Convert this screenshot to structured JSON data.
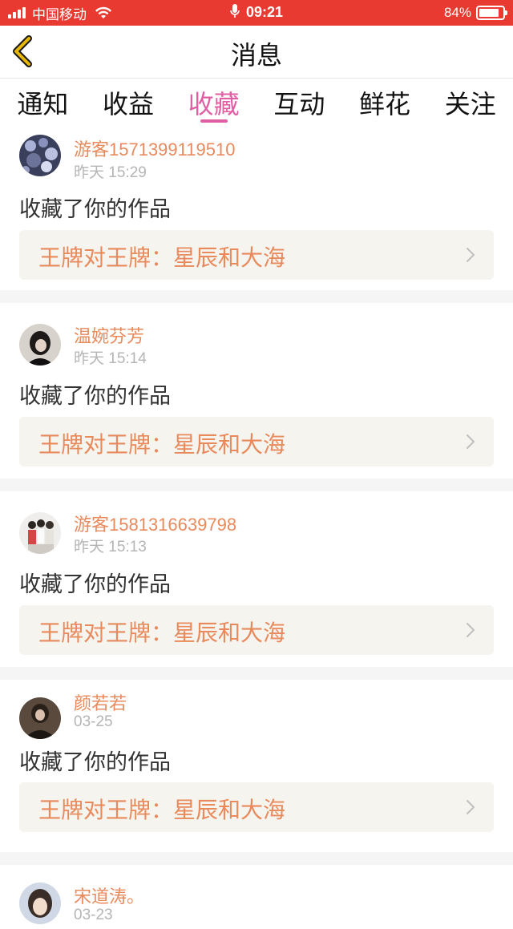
{
  "status_bar": {
    "carrier": "中国移动",
    "time": "09:21",
    "battery": "84%",
    "battery_level": 0.84,
    "icons": [
      "signal-icon",
      "wifi-icon",
      "microphone-icon",
      "battery-icon"
    ]
  },
  "nav": {
    "title": "消息",
    "back_icon": "chevron-left-icon"
  },
  "tabs": [
    {
      "label": "通知",
      "active": false
    },
    {
      "label": "收益",
      "active": false
    },
    {
      "label": "收藏",
      "active": true
    },
    {
      "label": "互动",
      "active": false
    },
    {
      "label": "鲜花",
      "active": false
    },
    {
      "label": "关注",
      "active": false
    }
  ],
  "notifications": [
    {
      "username": "游客1571399119510",
      "time": "昨天 15:29",
      "action": "收藏了你的作品",
      "work_title": "王牌对王牌：星辰和大海"
    },
    {
      "username": "温婉芬芳",
      "time": "昨天 15:14",
      "action": "收藏了你的作品",
      "work_title": "王牌对王牌：星辰和大海"
    },
    {
      "username": "游客1581316639798",
      "time": "昨天 15:13",
      "action": "收藏了你的作品",
      "work_title": "王牌对王牌：星辰和大海"
    },
    {
      "username": "颜若若",
      "time": "03-25",
      "action": "收藏了你的作品",
      "work_title": "王牌对王牌：星辰和大海"
    },
    {
      "username": "宋道涛。",
      "time": "03-23",
      "action": "",
      "work_title": ""
    }
  ],
  "colors": {
    "status_bar": "#e83a30",
    "accent_tab": "#e05ea3",
    "username": "#e88a5c",
    "back_arrow": "#e8b800"
  }
}
